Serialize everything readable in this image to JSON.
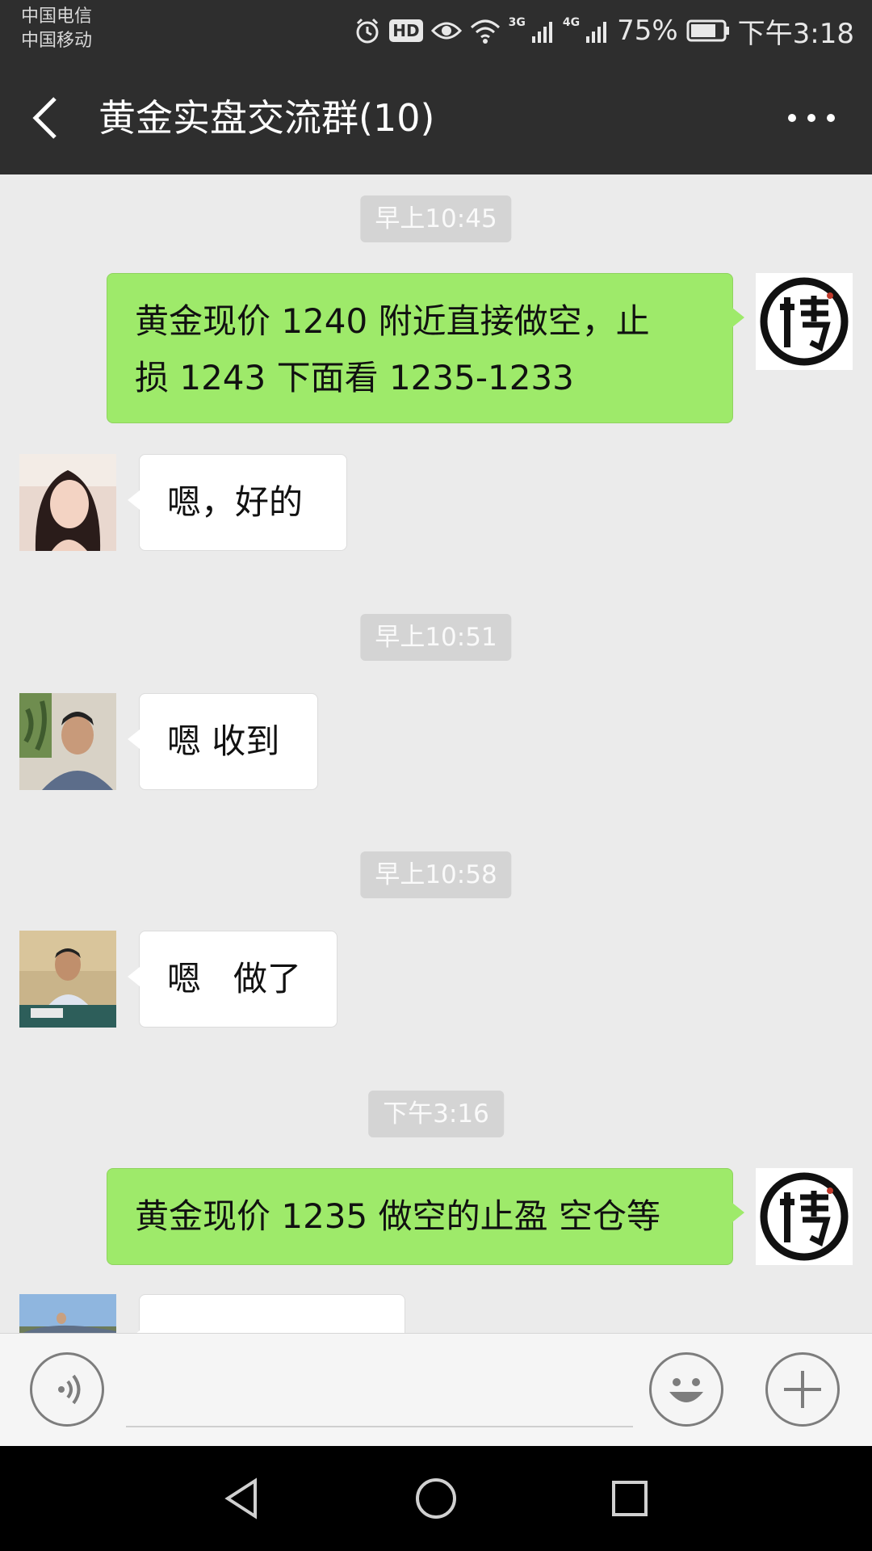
{
  "status_bar": {
    "carrier_1": "中国电信",
    "carrier_2": "中国移动",
    "hd_label": "HD",
    "signal_1_type": "3G",
    "signal_2_type": "4G",
    "battery": "75%",
    "time": "下午3:18",
    "icons": [
      "alarm-icon",
      "hd-icon",
      "eye-icon",
      "wifi-icon",
      "signal-icon",
      "battery-icon"
    ]
  },
  "header": {
    "back_icon": "back-arrow-icon",
    "title": "黄金实盘交流群(10)",
    "more_icon": "more-dots-icon"
  },
  "messages": [
    {
      "type": "time",
      "text": "早上10:45"
    },
    {
      "type": "msg",
      "side": "right",
      "avatar": "bo-logo-avatar",
      "text_line_1": "黄金现价 1240 附近直接做空，止",
      "text_line_2": "损 1243 下面看 1235-1233"
    },
    {
      "type": "msg",
      "side": "left",
      "avatar": "woman-avatar",
      "text": "嗯，好的"
    },
    {
      "type": "time",
      "text": "早上10:51"
    },
    {
      "type": "msg",
      "side": "left",
      "avatar": "man-plant-avatar",
      "text": "嗯 收到"
    },
    {
      "type": "time",
      "text": "早上10:58"
    },
    {
      "type": "msg",
      "side": "left",
      "avatar": "man-desk-avatar",
      "text": "嗯   做了"
    },
    {
      "type": "time",
      "text": "下午3:16"
    },
    {
      "type": "msg",
      "side": "right",
      "avatar": "bo-logo-avatar",
      "text": "黄金现价 1235 做空的止盈 空仓等"
    },
    {
      "type": "msg",
      "side": "left",
      "avatar": "landscape-avatar",
      "text": ""
    }
  ],
  "input_bar": {
    "voice_icon": "voice-icon",
    "input_value": "",
    "emoji_icon": "emoji-icon",
    "plus_icon": "plus-icon"
  },
  "nav_bar": {
    "icons": [
      "nav-back-icon",
      "nav-home-icon",
      "nav-recents-icon"
    ]
  },
  "colors": {
    "header_bg": "#2e2e2e",
    "chat_bg": "#ebebeb",
    "my_bubble": "#9eea6a",
    "other_bubble": "#ffffff",
    "timestamp_bg": "#d4d4d4"
  }
}
